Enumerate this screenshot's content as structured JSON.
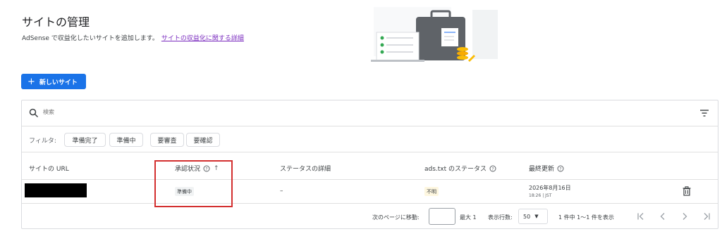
{
  "header": {
    "title": "サイトの管理",
    "description": "AdSense で収益化したいサイトを追加します。",
    "link": "サイトの収益化に関する詳細"
  },
  "toolbar": {
    "new_site_label": "新しいサイト",
    "new_site_icon": "plus-icon"
  },
  "search": {
    "placeholder": "検索",
    "icon": "search-icon",
    "filter_icon": "filter-list-icon"
  },
  "filters": {
    "label": "フィルタ:",
    "chips": [
      "準備完了",
      "準備中",
      "要審査",
      "要確認"
    ]
  },
  "table": {
    "columns": [
      "サイトの URL",
      "承認状況",
      "ステータスの詳細",
      "ads.txt のステータス",
      "最終更新"
    ],
    "rows": [
      {
        "url": "",
        "status": "準備中",
        "detail": "–",
        "ads_txt": "不明",
        "updated_date": "2026年8月16日",
        "updated_time": "18:26 | JST"
      }
    ]
  },
  "pagination": {
    "goto_label": "次のページに移動:",
    "goto_value": "",
    "max_label": "最大 1",
    "rows_label": "表示行数:",
    "rows_value": "50",
    "range_label": "1 件中 1〜1 件を表示"
  },
  "colors": {
    "primary": "#1a73e8",
    "highlight": "#d32f2f",
    "link": "#7b2cbf",
    "ads_chip_bg": "#fef7e0"
  }
}
